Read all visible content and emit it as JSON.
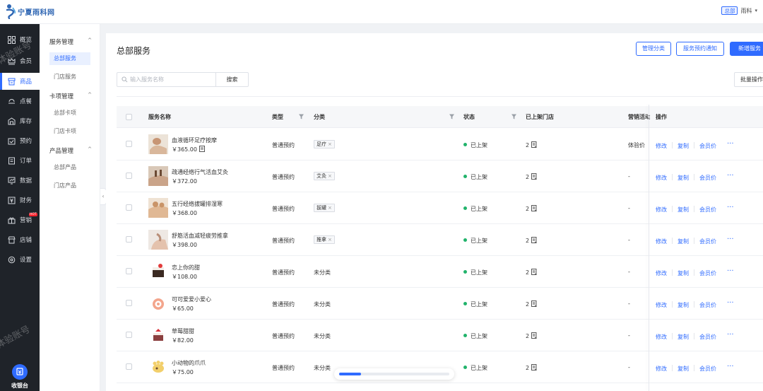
{
  "brand": {
    "name": "宁夏雨科网",
    "icon": "logo-icon",
    "color": "#2f66b3"
  },
  "topbar": {
    "store_badge": "总部",
    "user": "雨科",
    "caret": "▾"
  },
  "nav": {
    "items": [
      {
        "label": "概览",
        "icon": "grid-icon"
      },
      {
        "label": "会员",
        "icon": "crown-icon"
      },
      {
        "label": "商品",
        "icon": "shop-icon",
        "active": true
      },
      {
        "label": "点餐",
        "icon": "tray-icon"
      },
      {
        "label": "库存",
        "icon": "warehouse-icon"
      },
      {
        "label": "预约",
        "icon": "calendar-check-icon"
      },
      {
        "label": "订单",
        "icon": "order-icon"
      },
      {
        "label": "数据",
        "icon": "chart-icon"
      },
      {
        "label": "财务",
        "icon": "finance-icon"
      },
      {
        "label": "营销",
        "icon": "marketing-icon",
        "badge": "HOT"
      },
      {
        "label": "店铺",
        "icon": "store-icon"
      },
      {
        "label": "设置",
        "icon": "gear-icon"
      }
    ],
    "cashier": "收银台",
    "watermark": "体验账号"
  },
  "submenu": {
    "groups": [
      {
        "label": "服务管理",
        "items": [
          "总部服务",
          "门店服务"
        ]
      },
      {
        "label": "卡项管理",
        "items": [
          "总部卡项",
          "门店卡项"
        ]
      },
      {
        "label": "产品管理",
        "items": [
          "总部产品",
          "门店产品"
        ]
      }
    ],
    "active_item": "总部服务",
    "collapse_glyph": "‹"
  },
  "page": {
    "title": "总部服务",
    "buttons": {
      "categories": "管理分类",
      "notice": "服务预约通知",
      "add": "新增服务"
    },
    "search_placeholder": "输入服务名称",
    "search_button": "搜索",
    "batch_button": "批量操作"
  },
  "table": {
    "headers": {
      "name": "服务名称",
      "type": "类型",
      "category": "分类",
      "status": "状态",
      "stores": "已上架门店",
      "marketing": "营销活动",
      "actions": "操作"
    },
    "rows": [
      {
        "name": "血液循环足疗按摩",
        "price": "￥365.00",
        "type": "普通预约",
        "category": "足疗",
        "status": "已上架",
        "stores": "2",
        "marketing": "体验价"
      },
      {
        "name": "疏通经络行气活血艾灸",
        "price": "￥372.00",
        "type": "普通预约",
        "category": "艾灸",
        "status": "已上架",
        "stores": "2",
        "marketing": "-"
      },
      {
        "name": "五行经络拔罐排湿寒",
        "price": "￥368.00",
        "type": "普通预约",
        "category": "拔罐",
        "status": "已上架",
        "stores": "2",
        "marketing": "-"
      },
      {
        "name": "舒筋活血减轻疲劳推拿",
        "price": "￥398.00",
        "type": "普通预约",
        "category": "推拿",
        "status": "已上架",
        "stores": "2",
        "marketing": "-"
      },
      {
        "name": "恋上你的甜",
        "price": "￥108.00",
        "type": "普通预约",
        "category": "未分类",
        "status": "已上架",
        "stores": "2",
        "marketing": "-"
      },
      {
        "name": "可可爱爱小爱心",
        "price": "￥65.00",
        "type": "普通预约",
        "category": "未分类",
        "status": "已上架",
        "stores": "2",
        "marketing": "-"
      },
      {
        "name": "草莓甜甜",
        "price": "￥82.00",
        "type": "普通预约",
        "category": "未分类",
        "status": "已上架",
        "stores": "2",
        "marketing": "-"
      },
      {
        "name": "小动物的爪爪",
        "price": "￥75.00",
        "type": "普通预约",
        "category": "未分类",
        "status": "已上架",
        "stores": "2",
        "marketing": "-"
      }
    ],
    "row_actions": {
      "edit": "修改",
      "copy": "复制",
      "member_price": "会员价",
      "more": "···"
    }
  },
  "loading": {
    "progress": 0.2
  },
  "colors": {
    "primary": "#2f6bff",
    "status_on": "#21b36b",
    "nav_bg": "#1f2329"
  }
}
